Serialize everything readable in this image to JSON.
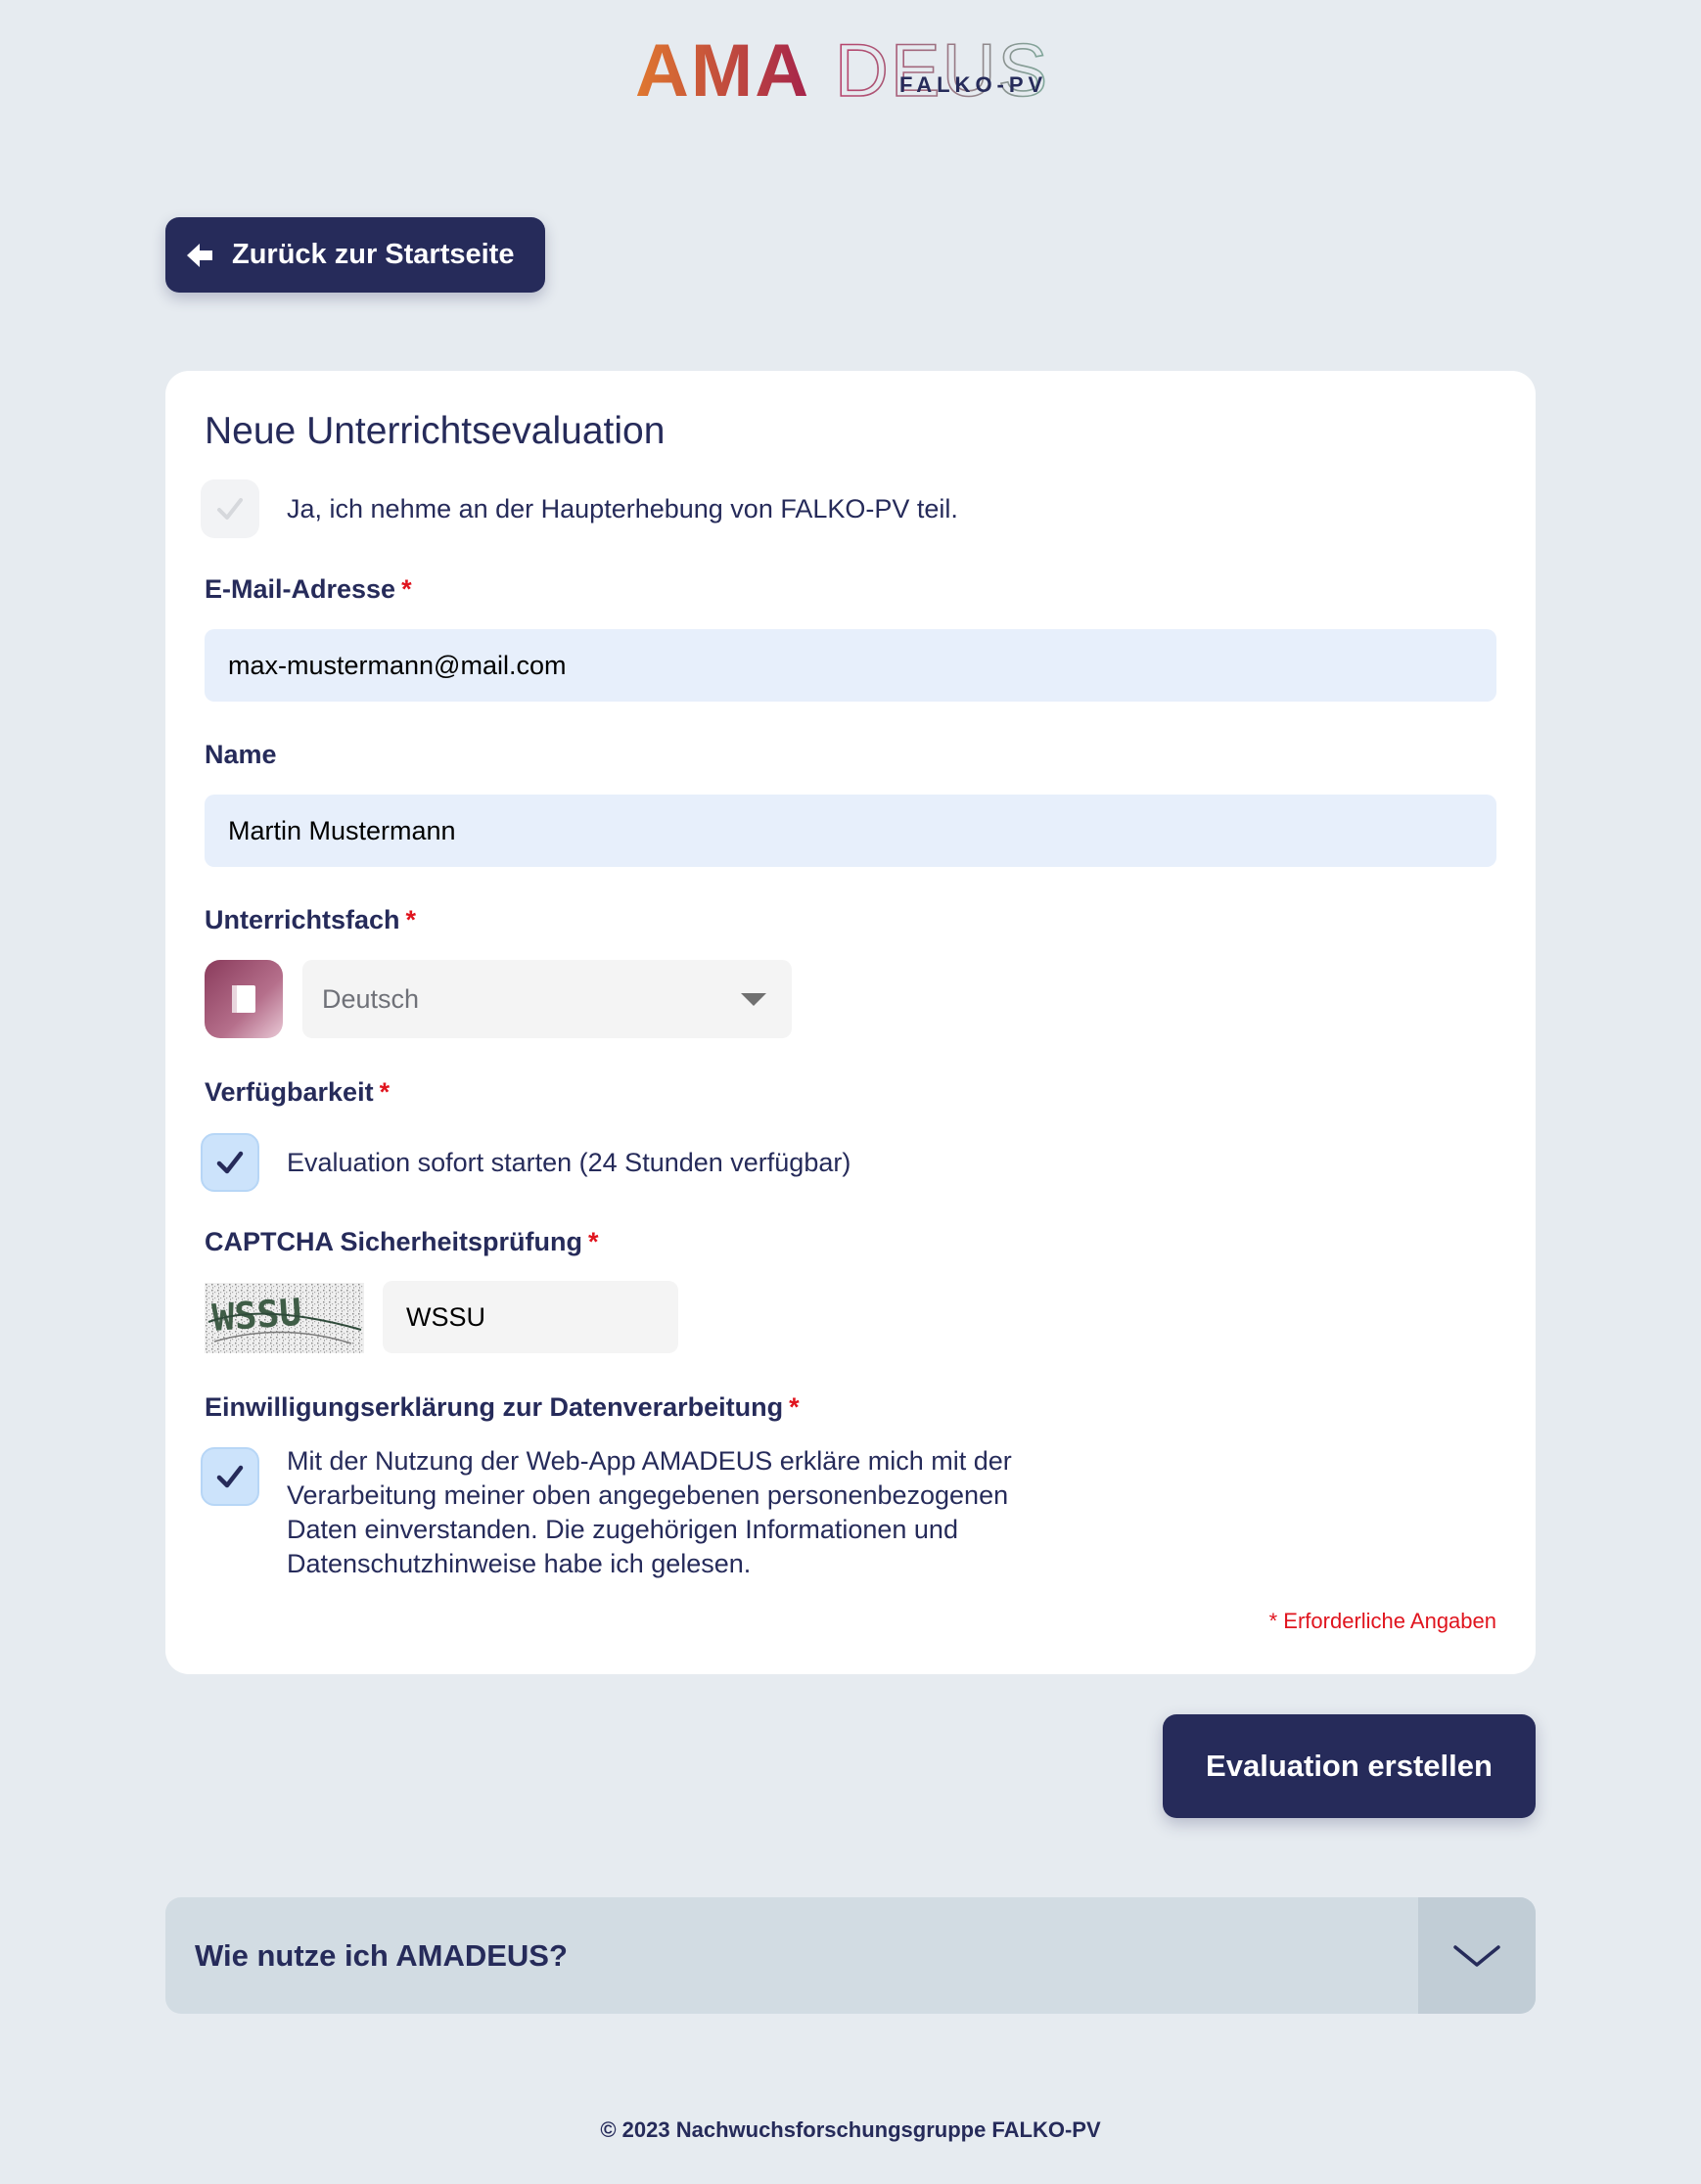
{
  "logo": {
    "part_bold": "AMA",
    "part_light": "DEUS",
    "subtitle": "FALKO-PV",
    "colors": {
      "bold_start": "#e0782f",
      "bold_end": "#a5234b",
      "light_start": "#b8406b",
      "light_end": "#7fa99b"
    }
  },
  "back_button": {
    "label": "Zurück zur Startseite",
    "icon": "arrow-left-icon"
  },
  "form": {
    "title": "Neue Unterrichtsevaluation",
    "main_survey": {
      "label": "Ja, ich nehme an der Haupterhebung von FALKO-PV teil.",
      "checked": true,
      "disabled": true
    },
    "email": {
      "label": "E-Mail-Adresse",
      "required_mark": "*",
      "value": "max-mustermann@mail.com"
    },
    "name": {
      "label": "Name",
      "value": "Martin Mustermann"
    },
    "subject": {
      "label": "Unterrichtsfach",
      "required_mark": "*",
      "selected": "Deutsch",
      "icon": "book-icon"
    },
    "availability": {
      "label": "Verfügbarkeit",
      "required_mark": "*",
      "option_label": "Evaluation sofort starten (24 Stunden verfügbar)",
      "checked": true
    },
    "captcha": {
      "label": "CAPTCHA Sicherheitsprüfung",
      "required_mark": "*",
      "image_text": "WSSU",
      "value": "WSSU"
    },
    "consent": {
      "label": "Einwilligungserklärung zur Datenverarbeitung",
      "required_mark": "*",
      "text": "Mit der Nutzung der Web-App AMADEUS erkläre mich mit der Verarbeitung meiner oben angegebenen personenbezogenen Daten einverstanden. Die zugehörigen Informationen und Datenschutzhinweise habe ich gelesen.",
      "checked": true
    },
    "required_note": "* Erforderliche Angaben"
  },
  "submit_button": {
    "label": "Evaluation erstellen"
  },
  "accordion": {
    "title": "Wie nutze ich AMADEUS?",
    "icon": "chevron-down-icon",
    "expanded": false
  },
  "footer": {
    "text": "© 2023 Nachwuchsforschungsgruppe FALKO-PV"
  },
  "colors": {
    "page_bg": "#e6ebf0",
    "primary": "#262b5a",
    "required": "#e0141e",
    "input_bg": "#e7effb",
    "checkbox_checked_bg": "#cce3fb"
  }
}
